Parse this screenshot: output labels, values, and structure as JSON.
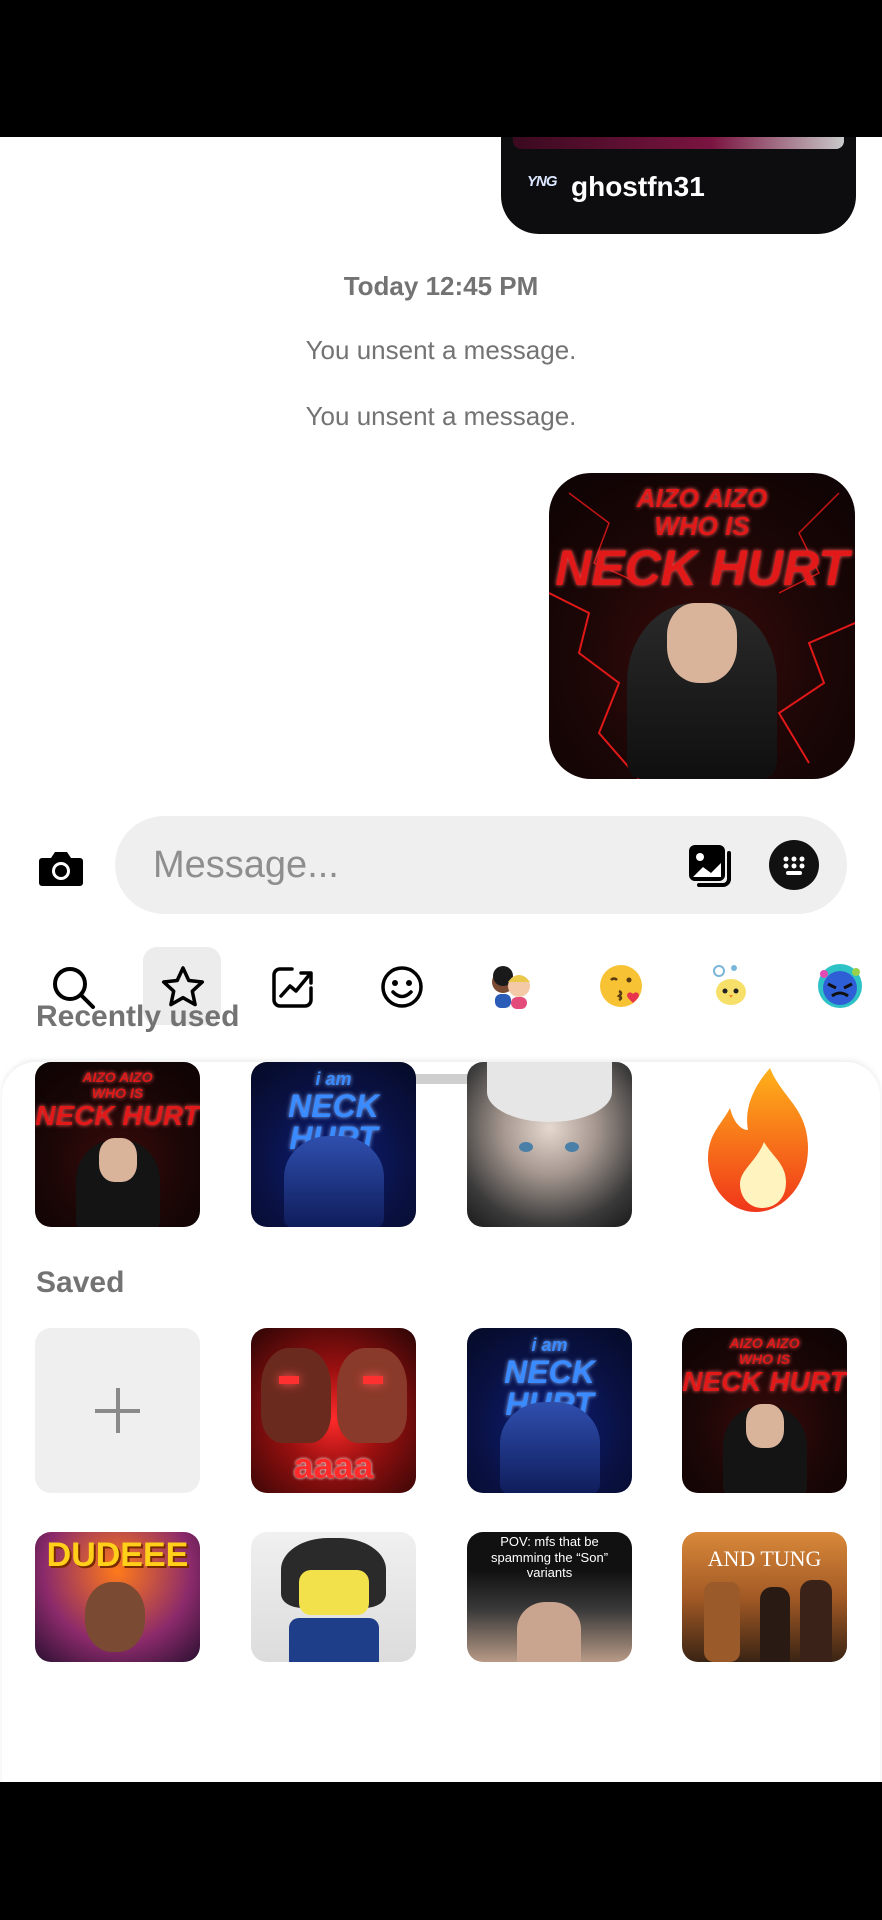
{
  "thread": {
    "shared_post": {
      "logo_text": "YNG",
      "username": "ghostfn31"
    },
    "timestamp": "Today 12:45 PM",
    "system_messages": [
      "You unsent a message.",
      "You unsent a message."
    ],
    "sent_sticker": {
      "line1": "AIZO AIZO",
      "line2": "WHO IS",
      "line3": "NECK HURT"
    }
  },
  "composer": {
    "placeholder": "Message...",
    "icons": [
      "camera-icon",
      "gallery-icon",
      "keypad-icon"
    ]
  },
  "sticker_tabs": [
    {
      "icon": "search-icon",
      "selected": false
    },
    {
      "icon": "star-icon",
      "selected": true
    },
    {
      "icon": "trending-icon",
      "selected": false
    },
    {
      "icon": "emoji-icon",
      "selected": false
    },
    {
      "icon": "avatar-pair-icon",
      "selected": false
    },
    {
      "icon": "kiss-emoji-icon",
      "selected": false
    },
    {
      "icon": "chick-icon",
      "selected": false
    },
    {
      "icon": "blue-monster-icon",
      "selected": false
    }
  ],
  "sheet": {
    "recent_title": "Recently used",
    "saved_title": "Saved",
    "recent": [
      {
        "kind": "neck-hurt-red",
        "line1": "AIZO AIZO",
        "line2": "WHO IS",
        "line3": "NECK HURT"
      },
      {
        "kind": "neck-hurt-blue",
        "line1": "i am",
        "line2": "NECK HURT"
      },
      {
        "kind": "white-hair-face"
      },
      {
        "kind": "fire-emoji"
      }
    ],
    "saved": [
      {
        "kind": "add-sticker"
      },
      {
        "kind": "screaming-red-eyes",
        "caption": "aaaa"
      },
      {
        "kind": "neck-hurt-blue",
        "line1": "i am",
        "line2": "NECK HURT"
      },
      {
        "kind": "neck-hurt-red",
        "line1": "AIZO AIZO",
        "line2": "WHO IS",
        "line3": "NECK HURT"
      },
      {
        "kind": "dudeee",
        "caption": "DUDEEE"
      },
      {
        "kind": "spongebob-hoodie"
      },
      {
        "kind": "pov-meme",
        "caption": "POV: mfs that be spamming the “Son” variants"
      },
      {
        "kind": "and-tung",
        "caption": "AND TUNG"
      }
    ]
  },
  "colors": {
    "accent_red": "#e11919",
    "accent_blue": "#3a8bff",
    "muted_text": "#737373",
    "input_bg": "#efefef"
  }
}
